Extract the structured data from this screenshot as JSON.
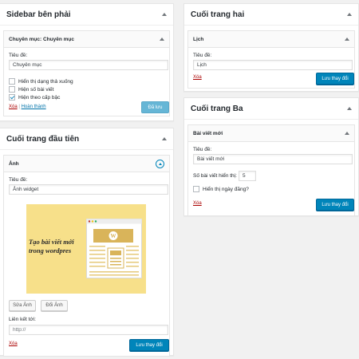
{
  "sidebar_right": {
    "title": "Sidebar bên phải",
    "widget_title": "Chuyên mục: Chuyên mục",
    "title_label": "Tiêu đề:",
    "title_value": "Chuyên mục",
    "options": [
      "Hiển thị dạng thả xuống",
      "Hiện số bài viết",
      "Hiện theo cấp bậc"
    ],
    "delete_label": "Xóa",
    "separator": "|",
    "done_label": "Hoàn thành",
    "save_label": "Đã lưu"
  },
  "footer_one": {
    "title": "Cuối trang đầu tiên",
    "widget_title": "Ảnh",
    "title_label": "Tiêu đề:",
    "title_value": "Ảnh widget",
    "image_caption_line1": "Tạo bài viết mới",
    "image_caption_line2": "trong wordpres",
    "edit_image_label": "Sửa Ảnh",
    "change_image_label": "Đổi Ảnh",
    "link_label": "Liên kết tới:",
    "link_placeholder": "http://",
    "delete_label": "Xóa",
    "save_label": "Lưu thay đổi"
  },
  "footer_two": {
    "title": "Cuối trang hai",
    "widget_title": "Lịch",
    "title_label": "Tiêu đề:",
    "title_value": "Lịch",
    "delete_label": "Xóa",
    "save_label": "Lưu thay đổi"
  },
  "footer_three": {
    "title": "Cuối trang Ba",
    "widget_title": "Bài viết mới",
    "title_label": "Tiêu đề:",
    "title_value": "Bài viết mới",
    "count_label": "Số bài viết hiển thị:",
    "count_value": "5",
    "show_date_label": "Hiển thị ngày đăng?",
    "delete_label": "Xóa",
    "save_label": "Lưu thay đổi"
  },
  "colors": {
    "primary_button": "#0085ba",
    "delete_link": "#a00",
    "image_background": "#f7e08a"
  }
}
